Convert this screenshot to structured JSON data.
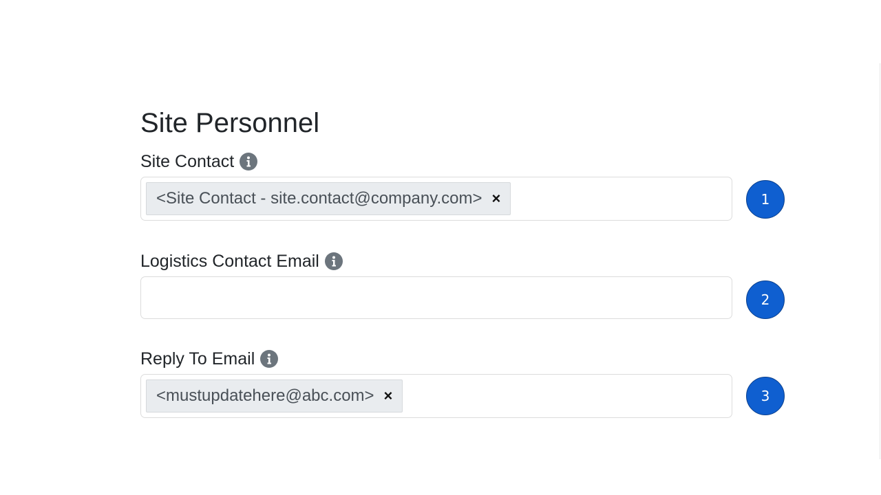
{
  "section": {
    "title": "Site Personnel"
  },
  "fields": [
    {
      "label": "Site Contact",
      "info_icon": "info-icon",
      "tags": [
        "<Site Contact - site.contact@company.com>"
      ],
      "remove_glyph": "×",
      "step": "1"
    },
    {
      "label": "Logistics Contact Email",
      "info_icon": "info-icon",
      "value": "",
      "step": "2"
    },
    {
      "label": "Reply To Email",
      "info_icon": "info-icon",
      "tags": [
        "<mustupdatehere@abc.com>"
      ],
      "remove_glyph": "×",
      "step": "3"
    }
  ],
  "colors": {
    "badge": "#0f5fd0",
    "tag_bg": "#e9ecef",
    "info_icon": "#6c757d",
    "text": "#212529"
  }
}
